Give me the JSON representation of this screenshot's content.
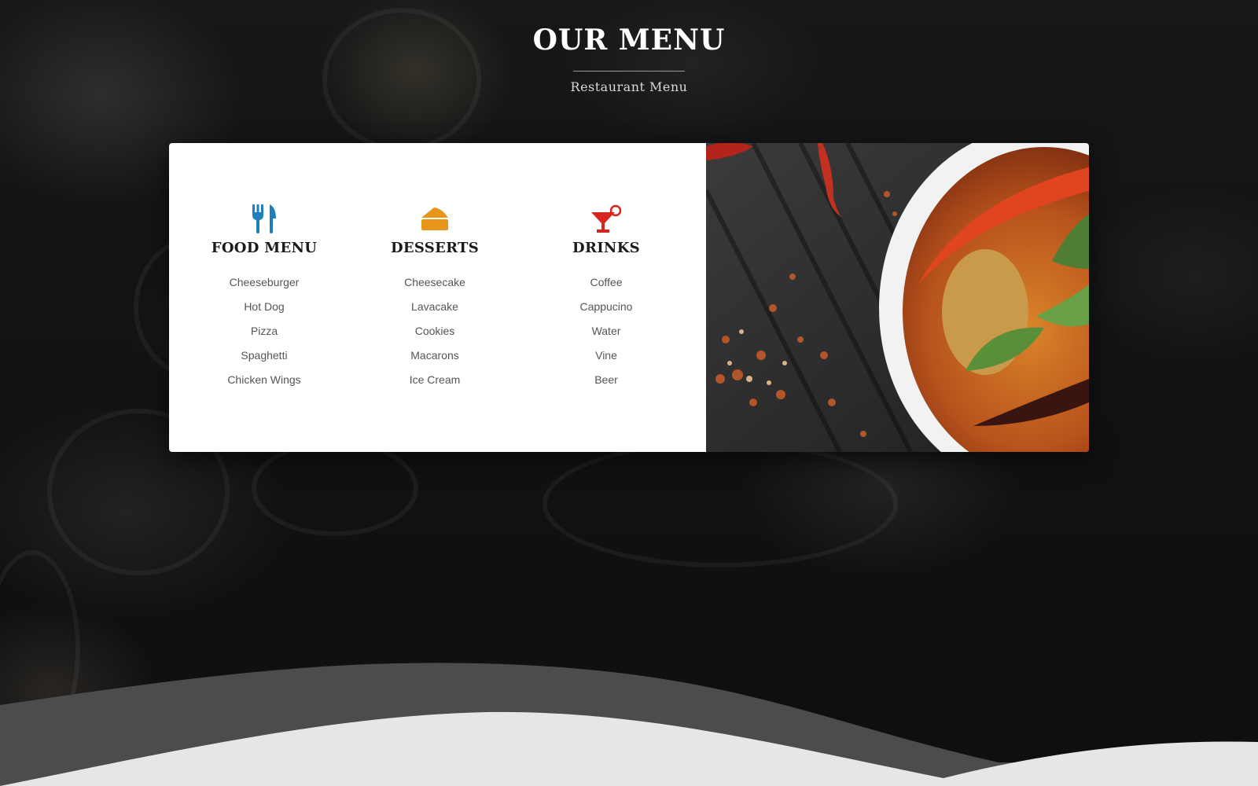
{
  "header": {
    "title": "OUR MENU",
    "subtitle": "Restaurant Menu"
  },
  "menu": {
    "columns": [
      {
        "heading": "FOOD MENU",
        "icon": "fork-knife-icon",
        "icon_color": "#1e7fbf",
        "items": [
          "Cheeseburger",
          "Hot Dog",
          "Pizza",
          "Spaghetti",
          "Chicken Wings"
        ]
      },
      {
        "heading": "DESSERTS",
        "icon": "cake-icon",
        "icon_color": "#e8961a",
        "items": [
          "Cheesecake",
          "Lavacake",
          "Cookies",
          "Macarons",
          "Ice Cream"
        ]
      },
      {
        "heading": "DRINKS",
        "icon": "cocktail-icon",
        "icon_color": "#d7261e",
        "items": [
          "Coffee",
          "Cappucino",
          "Water",
          "Vine",
          "Beer"
        ]
      }
    ]
  },
  "colors": {
    "background": "#121314",
    "card": "#ffffff",
    "heading_text": "#1b1b1b",
    "item_text": "#555555"
  }
}
